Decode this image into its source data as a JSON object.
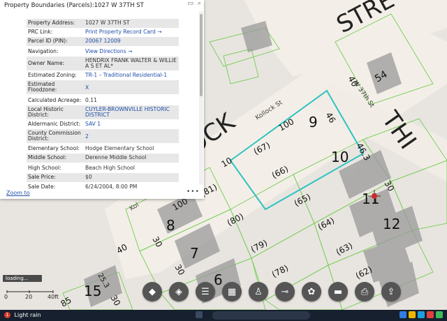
{
  "popup": {
    "title": "Property Boundaries (Parcels):1027 W 37TH ST",
    "rows": [
      {
        "label": "Property Address:",
        "value": "1027 W 37TH ST"
      },
      {
        "label": "PRC Link:",
        "value": "Print Property Record Card →"
      },
      {
        "label": "Parcel ID (PIN):",
        "value": "20067 12009"
      },
      {
        "label": "Navigation:",
        "value": "View Directions →"
      },
      {
        "label": "Owner Name:",
        "value": "HENDRIX FRANK WALTER & WILLIE A S ET AL*"
      },
      {
        "label": "Estimated Zoning:",
        "value": "TR-1 – Traditional Residential-1"
      },
      {
        "label": "Estimated Floodzone:",
        "value": "X"
      },
      {
        "label": "Calculated Acreage:",
        "value": "0.11"
      },
      {
        "label": "Local Historic District:",
        "value": "CUYLER-BROWNVILLE HISTORIC DISTRICT"
      },
      {
        "label": "Aldermanic District:",
        "value": "SAV 1"
      },
      {
        "label": "County Commission District:",
        "value": "2"
      },
      {
        "label": "Elementary School:",
        "value": "Hodge Elementary School"
      },
      {
        "label": "Middle School:",
        "value": "Derenne Middle School"
      },
      {
        "label": "High School:",
        "value": "Beach High School"
      },
      {
        "label": "Sale Price:",
        "value": "$0"
      },
      {
        "label": "Sale Date:",
        "value": "6/24/2004, 8:00 PM"
      }
    ],
    "zoom_to": "Zoom to",
    "more": "•••"
  },
  "map": {
    "street_labels": {
      "kollock_big": "KOLLOCK",
      "kollock_small": "Kollock St",
      "kollock_small2": "Kol",
      "w37": "W 37th St",
      "street_big": "STRE",
      "third_big": "THI"
    },
    "lot_numbers": [
      "9",
      "10",
      "11",
      "12",
      "8",
      "7",
      "6",
      "15",
      "54"
    ],
    "parcel_labels": [
      "(67)",
      "(66)",
      "(65)",
      "(64)",
      "(63)",
      "(62)",
      "(81)",
      "(80)",
      "(79)",
      "(78)"
    ],
    "dimensions": [
      "100",
      "46",
      "10",
      "46.3",
      "40",
      "30",
      "100",
      "30",
      "40",
      "30",
      "25.3",
      "85",
      "30"
    ]
  },
  "loading": "loading...",
  "scale": {
    "labels": [
      "0",
      "20",
      "40ft"
    ]
  },
  "toolbar_icons": [
    "basemap-icon",
    "layers-icon",
    "legend-list-icon",
    "grid-icon",
    "person-icon",
    "measure-icon",
    "palette-icon",
    "ruler-icon",
    "print-icon",
    "share-icon"
  ],
  "taskbar": {
    "weather_badge": "1",
    "weather_text": "Light rain"
  }
}
